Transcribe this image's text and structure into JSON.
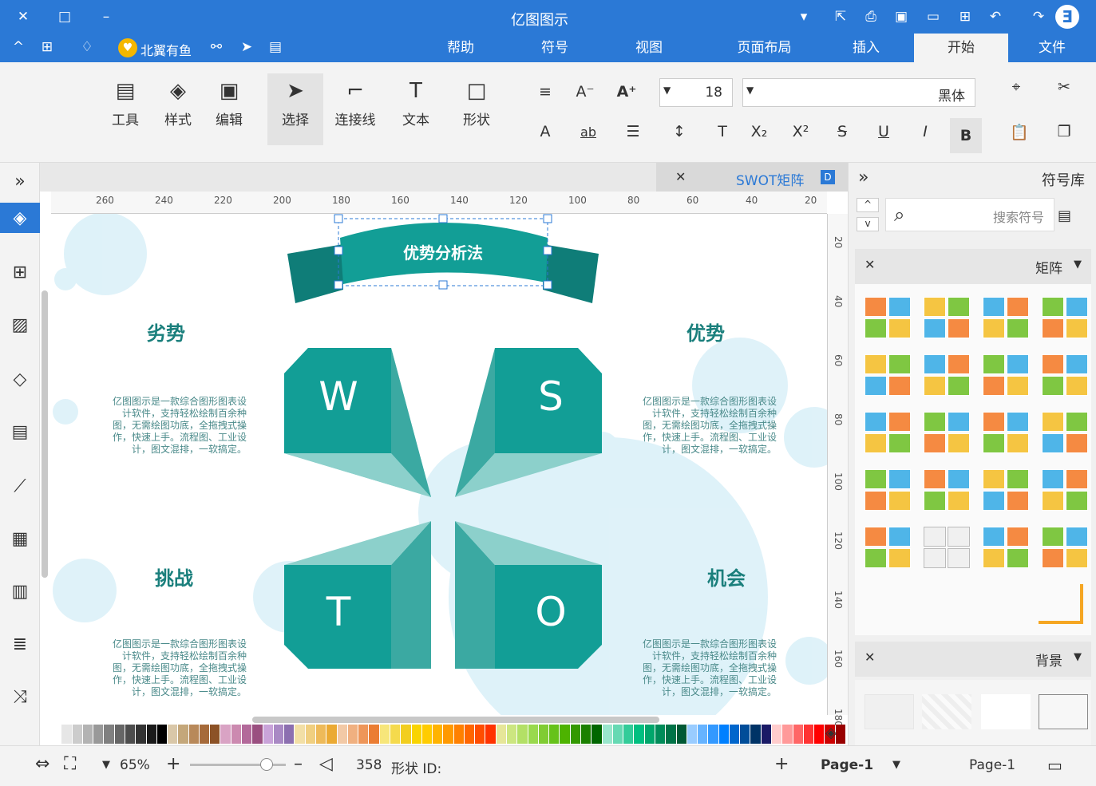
{
  "app": {
    "title": "亿图图示"
  },
  "titlebar": {
    "brand": "北翼有鱼"
  },
  "menu": {
    "tabs": [
      "文件",
      "开始",
      "插入",
      "页面布局",
      "视图",
      "符号",
      "帮助"
    ],
    "active": "开始"
  },
  "ribbon": {
    "font_name": "黑体",
    "font_size": "18",
    "tools": [
      "形状",
      "文本",
      "连接线",
      "选择",
      "编辑",
      "样式",
      "工具"
    ],
    "selected_tool": "选择"
  },
  "document": {
    "tab_title": "SWOT矩阵"
  },
  "ruler": {
    "h_ticks": [
      "20",
      "40",
      "60",
      "80",
      "100",
      "120",
      "140",
      "160",
      "180",
      "200",
      "220",
      "240",
      "260"
    ],
    "v_ticks": [
      "20",
      "40",
      "60",
      "80",
      "100",
      "120",
      "140",
      "160",
      "180"
    ]
  },
  "diagram": {
    "banner_title": "优势分析法",
    "quadrants": [
      {
        "title": "优势",
        "letter": "S"
      },
      {
        "title": "劣势",
        "letter": "W"
      },
      {
        "title": "机会",
        "letter": "O"
      },
      {
        "title": "挑战",
        "letter": "T"
      }
    ],
    "body_text": "亿图图示是一款综合图形图表设计软件，支持轻松绘制百余种图，无需绘图功底，全拖拽式操作，快速上手。流程图、工业设计，图文混排，一软搞定。",
    "colors": {
      "teal": "#129e96",
      "teal_dark": "#0f7d78",
      "teal_light": "#57bfb8",
      "title": "#1a7f7c"
    }
  },
  "right_panel": {
    "title": "符号库",
    "search_placeholder": "搜索符号",
    "section_matrix": "矩阵",
    "section_background": "背景"
  },
  "status": {
    "page_label": "Page-1",
    "page_tab": "Page-1",
    "shape_id_label": "形状 ID:",
    "shape_id": "358",
    "zoom": "65%"
  }
}
